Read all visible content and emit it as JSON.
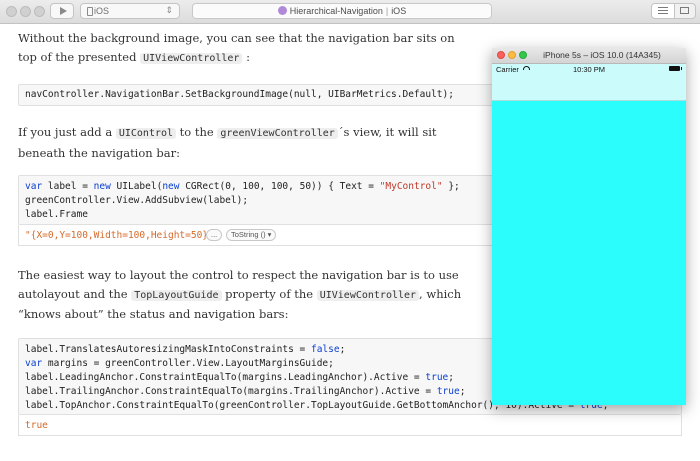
{
  "toolbar": {
    "target_label": "iOS",
    "doc_name": "Hierarchical-Navigation",
    "doc_platform": "iOS"
  },
  "document": {
    "para1": {
      "t1": "Without the background image, you can see that the navigation bar sits on top of the presented ",
      "c1": "UIViewController",
      "t2": " :"
    },
    "code1": [
      "navController.NavigationBar.SetBackgroundImage(null, UIBarMetrics.Default);"
    ],
    "para2": {
      "t1": "If you just add a ",
      "c1": "UIControl",
      "t2": " to the ",
      "c2": "greenViewController",
      "t3": "´s view, it will sit beneath the navigation bar:"
    },
    "code2": {
      "l1_kw1": "var",
      "l1_a": " label = ",
      "l1_kw2": "new",
      "l1_b": " UILabel(",
      "l1_kw3": "new",
      "l1_c": " CGRect(0, 100, 100, 50)) { Text = ",
      "l1_str": "\"MyControl\"",
      "l1_d": " };",
      "l2": "greenController.View.AddSubview(label);",
      "l3": "label.Frame"
    },
    "result2": {
      "value": "\"{X=0,Y=100,Width=100,Height=50}\"",
      "more_button": "...",
      "tostring_button": "ToString () ▾"
    },
    "para3": {
      "t1": "The easiest way to layout the control to respect the navigation bar is to use autolayout and the ",
      "c1": "TopLayoutGuide",
      "t2": " property of the ",
      "c2": "UIViewController",
      "t3": ", which “knows about” the status and navigation bars:"
    },
    "code3": {
      "l1_a": "label.TranslatesAutoresizingMaskIntoConstraints = ",
      "l1_kw": "false",
      "l1_b": ";",
      "l2_kw": "var",
      "l2_a": " margins = greenController.View.LayoutMarginsGuide;",
      "l3_a": "label.LeadingAnchor.ConstraintEqualTo(margins.LeadingAnchor).Active = ",
      "l3_kw": "true",
      "l3_b": ";",
      "l4_a": "label.TrailingAnchor.ConstraintEqualTo(margins.TrailingAnchor).Active = ",
      "l4_kw": "true",
      "l4_b": ";",
      "l5_a": "label.TopAnchor.ConstraintEqualTo(greenController.TopLayoutGuide.GetBottomAnchor(), 10).Active = ",
      "l5_kw": "true",
      "l5_b": ";"
    },
    "result3": {
      "value": "true"
    }
  },
  "simulator": {
    "title": "iPhone 5s – iOS 10.0 (14A345)",
    "carrier": "Carrier",
    "time": "10:30 PM",
    "screen_color": "#2afdfb",
    "navbar_color": "#cbfbfa"
  }
}
